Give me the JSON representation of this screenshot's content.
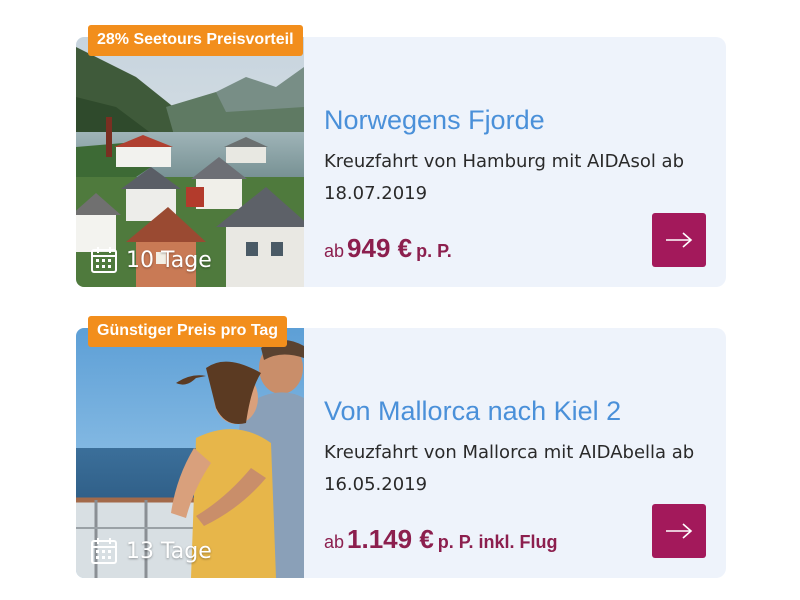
{
  "offers": [
    {
      "badge": "28% Seetours Preisvorteil",
      "title": "Norwegens Fjorde",
      "subtitle": "Kreuzfahrt von Hamburg mit AIDAsol ab 18.07.2019",
      "price_prefix": "ab",
      "price_amount": "949 €",
      "price_suffix": "p. P.",
      "duration": "10 Tage",
      "image": "norway-fjord-village-photo"
    },
    {
      "badge": "Günstiger Preis pro Tag",
      "title": "Von Mallorca nach Kiel 2",
      "subtitle": "Kreuzfahrt von Mallorca mit AIDAbella ab 16.05.2019",
      "price_prefix": "ab",
      "price_amount": "1.149 €",
      "price_suffix": "p. P. inkl. Flug",
      "duration": "13 Tage",
      "image": "couple-on-ship-deck-photo"
    }
  ],
  "colors": {
    "card_bg": "#eef3fb",
    "badge_bg": "#f28e1c",
    "title": "#4a90d9",
    "price": "#8c1f4e",
    "button_bg": "#a3195b"
  },
  "icons": {
    "duration": "calendar-icon",
    "details": "arrow-right-icon"
  }
}
